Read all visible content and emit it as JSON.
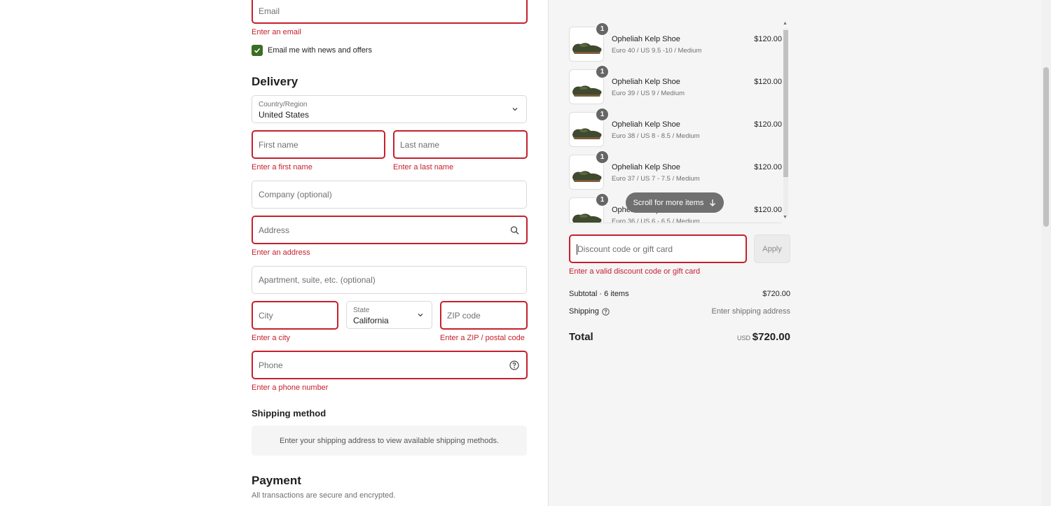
{
  "contact": {
    "email_placeholder": "Email",
    "email_error": "Enter an email",
    "newsletter_label": "Email me with news and offers",
    "newsletter_checked": true
  },
  "delivery": {
    "heading": "Delivery",
    "country_label": "Country/Region",
    "country_value": "United States",
    "first_name_placeholder": "First name",
    "first_name_error": "Enter a first name",
    "last_name_placeholder": "Last name",
    "last_name_error": "Enter a last name",
    "company_placeholder": "Company (optional)",
    "address_placeholder": "Address",
    "address_error": "Enter an address",
    "apartment_placeholder": "Apartment, suite, etc. (optional)",
    "city_placeholder": "City",
    "city_error": "Enter a city",
    "state_label": "State",
    "state_value": "California",
    "zip_placeholder": "ZIP code",
    "zip_error": "Enter a ZIP / postal code",
    "phone_placeholder": "Phone",
    "phone_error": "Enter a phone number"
  },
  "shipping_method": {
    "heading": "Shipping method",
    "message": "Enter your shipping address to view available shipping methods."
  },
  "payment": {
    "heading": "Payment",
    "subtitle": "All transactions are secure and encrypted."
  },
  "order": {
    "items": [
      {
        "qty": "1",
        "name": "Opheliah Kelp Shoe",
        "variant": "Euro 40 / US 9.5 -10 / Medium",
        "price": "$120.00"
      },
      {
        "qty": "1",
        "name": "Opheliah Kelp Shoe",
        "variant": "Euro 39 / US 9 / Medium",
        "price": "$120.00"
      },
      {
        "qty": "1",
        "name": "Opheliah Kelp Shoe",
        "variant": "Euro 38 / US 8 - 8.5 / Medium",
        "price": "$120.00"
      },
      {
        "qty": "1",
        "name": "Opheliah Kelp Shoe",
        "variant": "Euro 37 / US 7 - 7.5 / Medium",
        "price": "$120.00"
      },
      {
        "qty": "1",
        "name": "Opheliah Kelp Shoe",
        "variant": "Euro 36 / US 6 - 6.5 / Medium",
        "price": "$120.00"
      }
    ],
    "scroll_hint": "Scroll for more items",
    "discount_placeholder": "Discount code or gift card",
    "discount_error": "Enter a valid discount code or gift card",
    "apply_label": "Apply",
    "subtotal_label": "Subtotal · 6 items",
    "subtotal_value": "$720.00",
    "shipping_label": "Shipping",
    "shipping_value": "Enter shipping address",
    "total_label": "Total",
    "total_currency": "USD",
    "total_value": "$720.00"
  },
  "colors": {
    "error": "#c6202c",
    "checkbox": "#3b6e22",
    "summary_bg": "#f5f5f5"
  }
}
